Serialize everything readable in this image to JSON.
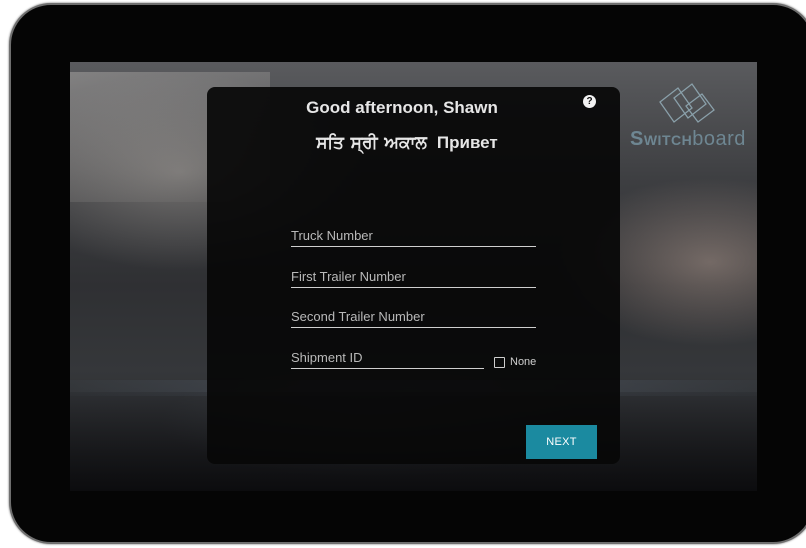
{
  "greeting": "Good afternoon, Shawn",
  "hellos": [
    "ਸਤਿ ਸ੍ਰੀ ਅਕਾਲ",
    "Привет"
  ],
  "help_icon": "?",
  "brand": {
    "word_strong": "Switch",
    "word_light": "board",
    "color": "#6e8692"
  },
  "form": {
    "truck_placeholder": "Truck Number",
    "first_trailer_placeholder": "First Trailer Number",
    "second_trailer_placeholder": "Second Trailer Number",
    "shipment_placeholder": "Shipment ID",
    "none_label": "None"
  },
  "next_label": "NEXT",
  "colors": {
    "accent": "#1b8aa0",
    "panel": "#080808"
  }
}
